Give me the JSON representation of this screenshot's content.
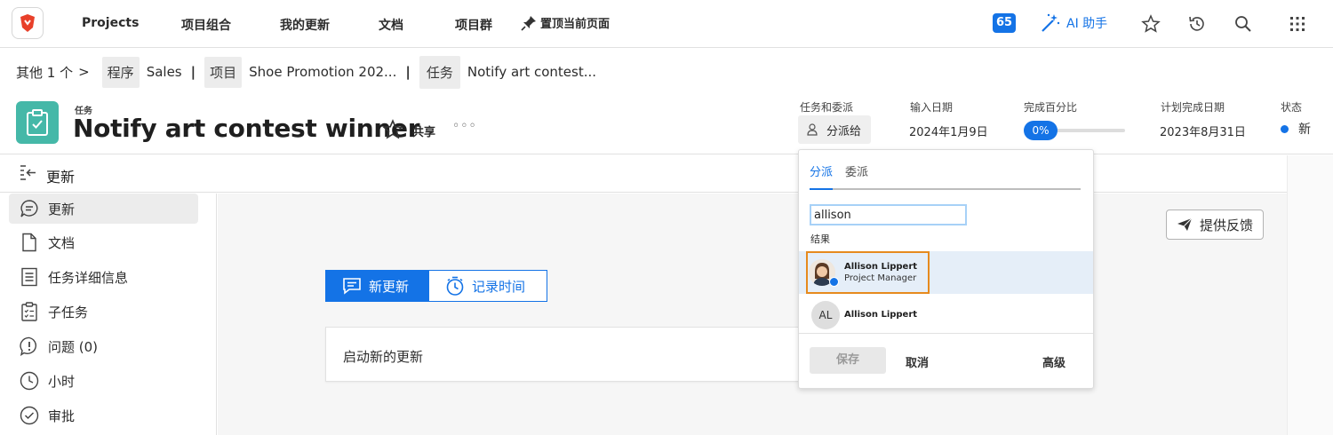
{
  "topnav": {
    "items": [
      "Projects",
      "项目组合",
      "我的更新",
      "文档",
      "项目群"
    ],
    "pin_label": "置顶当前页面",
    "notification_count": "65",
    "ai_label": "AI 助手"
  },
  "breadcrumb": {
    "more": "其他 1 个",
    "more_chevron": ">",
    "program_tag": "程序",
    "program_name": "Sales",
    "project_tag": "项目",
    "project_name": "Shoe Promotion 202...",
    "task_tag": "任务",
    "task_name": "Notify art contest...",
    "separator": "|"
  },
  "header": {
    "object_type": "任务",
    "title": "Notify art contest winner",
    "share_label": "共享",
    "more_label": "◦◦◦",
    "fields": {
      "assign_label": "任务和委派",
      "assign_value": "分派给",
      "entry_date_label": "输入日期",
      "entry_date_value": "2024年1月9日",
      "percent_label": "完成百分比",
      "percent_value": "0%",
      "planned_label": "计划完成日期",
      "planned_value": "2023年8月31日",
      "status_label": "状态",
      "status_value": "新"
    }
  },
  "updates_bar": {
    "title": "更新"
  },
  "sidebar": {
    "items": [
      {
        "label": "更新",
        "icon": "chat-bubble-icon"
      },
      {
        "label": "文档",
        "icon": "document-icon"
      },
      {
        "label": "任务详细信息",
        "icon": "task-details-icon"
      },
      {
        "label": "子任务",
        "icon": "checklist-icon"
      },
      {
        "label": "问题 (0)",
        "icon": "issue-icon"
      },
      {
        "label": "小时",
        "icon": "clock-icon"
      },
      {
        "label": "审批",
        "icon": "approval-icon"
      }
    ]
  },
  "main": {
    "feedback_label": "提供反馈",
    "new_update_tab": "新更新",
    "log_time_tab": "记录时间",
    "new_update_placeholder": "启动新的更新"
  },
  "assign_popover": {
    "tab_assign": "分派",
    "tab_delegate": "委派",
    "search_value": "allison",
    "results_label": "结果",
    "results": [
      {
        "name": "Allison Lippert",
        "role": "Project Manager"
      },
      {
        "name": "Allison Lippert",
        "initials": "AL"
      }
    ],
    "save_label": "保存",
    "cancel_label": "取消",
    "advanced_label": "高级"
  },
  "colors": {
    "accent": "#1473e6",
    "task_icon": "#45b8a8",
    "highlight_border": "#e68a1e",
    "selected_row": "#e5eef8"
  }
}
